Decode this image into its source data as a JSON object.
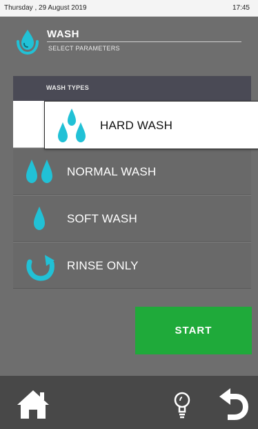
{
  "status_bar": {
    "date": "Thursday , 29 August 2019",
    "time": "17:45"
  },
  "header": {
    "icon": "hand-water-icon",
    "title": "WASH",
    "subtitle": "SELECT PARAMETERS"
  },
  "wash_types": {
    "header_label": "WASH TYPES",
    "selected": {
      "label": "HARD WASH",
      "icon": "three-drops-icon"
    },
    "options": [
      {
        "label": "NORMAL WASH",
        "icon": "two-drops-icon"
      },
      {
        "label": "SOFT WASH",
        "icon": "one-drop-icon"
      },
      {
        "label": "RINSE ONLY",
        "icon": "rinse-arrow-icon"
      }
    ]
  },
  "start_button": {
    "label": "START"
  },
  "bottom_bar": {
    "icons": [
      "home-icon",
      "lightbulb-icon",
      "back-icon"
    ]
  },
  "colors": {
    "background": "#6e6e6e",
    "accent_cyan": "#21c1d6",
    "start_green": "#1faa3a",
    "panel_header": "#4a4a55",
    "bottom_bar": "#484848"
  }
}
